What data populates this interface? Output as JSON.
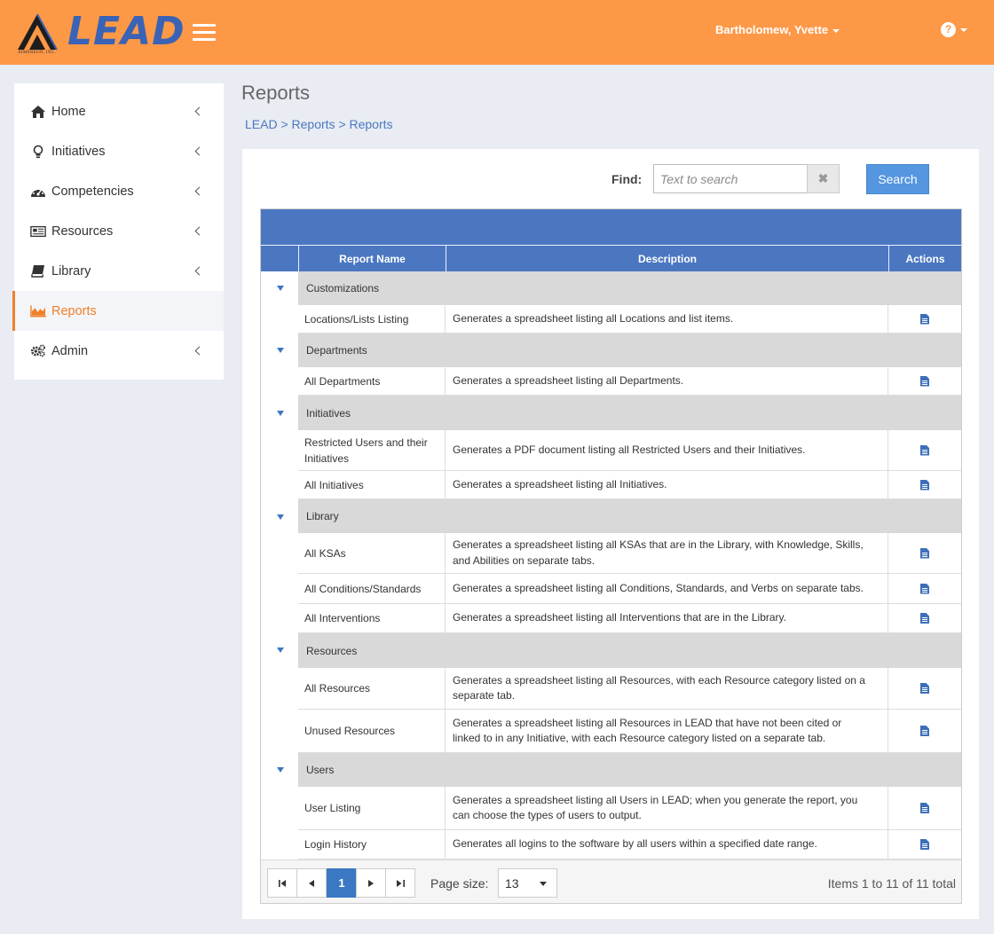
{
  "header": {
    "brand": "LEAD",
    "company": "AIMEREON, INC.",
    "user_name": "Bartholomew, Yvette",
    "help_icon": "question-circle-icon"
  },
  "sidebar": {
    "items": [
      {
        "label": "Home",
        "icon": "home-icon"
      },
      {
        "label": "Initiatives",
        "icon": "lightbulb-icon"
      },
      {
        "label": "Competencies",
        "icon": "dashboard-icon"
      },
      {
        "label": "Resources",
        "icon": "newspaper-icon"
      },
      {
        "label": "Library",
        "icon": "book-icon"
      },
      {
        "label": "Reports",
        "icon": "area-chart-icon",
        "active": true
      },
      {
        "label": "Admin",
        "icon": "gears-icon"
      }
    ],
    "accent_color": "#f07f2a"
  },
  "page": {
    "title": "Reports",
    "breadcrumb": "LEAD > Reports > Reports"
  },
  "search": {
    "find_label": "Find:",
    "placeholder": "Text to search",
    "clear_label": "✖",
    "button_label": "Search"
  },
  "grid": {
    "columns": [
      "Report Name",
      "Description",
      "Actions"
    ],
    "groups": [
      {
        "name": "Customizations",
        "rows": [
          {
            "name": "Locations/Lists Listing",
            "desc": "Generates a spreadsheet listing all Locations and list items."
          }
        ]
      },
      {
        "name": "Departments",
        "rows": [
          {
            "name": "All Departments",
            "desc": "Generates a spreadsheet listing all Departments."
          }
        ]
      },
      {
        "name": "Initiatives",
        "rows": [
          {
            "name": "Restricted Users and their Initiatives",
            "desc": "Generates a PDF document listing all Restricted Users and their Initiatives."
          },
          {
            "name": "All Initiatives",
            "desc": "Generates a spreadsheet listing all Initiatives."
          }
        ]
      },
      {
        "name": "Library",
        "rows": [
          {
            "name": "All KSAs",
            "desc": "Generates a spreadsheet listing all KSAs that are in the Library, with Knowledge, Skills, and Abilities on separate tabs."
          },
          {
            "name": "All Conditions/Standards",
            "desc": "Generates a spreadsheet listing all Conditions, Standards, and Verbs on separate tabs."
          },
          {
            "name": "All Interventions",
            "desc": "Generates a spreadsheet listing all Interventions that are in the Library."
          }
        ]
      },
      {
        "name": "Resources",
        "rows": [
          {
            "name": "All Resources",
            "desc": "Generates a spreadsheet listing all Resources, with each Resource category listed on a separate tab."
          },
          {
            "name": "Unused Resources",
            "desc": "Generates a spreadsheet listing all Resources in LEAD that have not been cited or linked to in any Initiative, with each Resource category listed on a separate tab."
          }
        ]
      },
      {
        "name": "Users",
        "rows": [
          {
            "name": "User Listing",
            "desc": "Generates a spreadsheet listing all Users in LEAD; when you generate the report, you can choose the types of users to output."
          },
          {
            "name": "Login History",
            "desc": "Generates all logins to the software by all users within a specified date range."
          }
        ]
      }
    ],
    "header_color": "#4b77c1"
  },
  "pager": {
    "current_page": "1",
    "page_size_label": "Page size:",
    "page_size": "13",
    "info": "Items 1 to 11 of 11 total"
  }
}
